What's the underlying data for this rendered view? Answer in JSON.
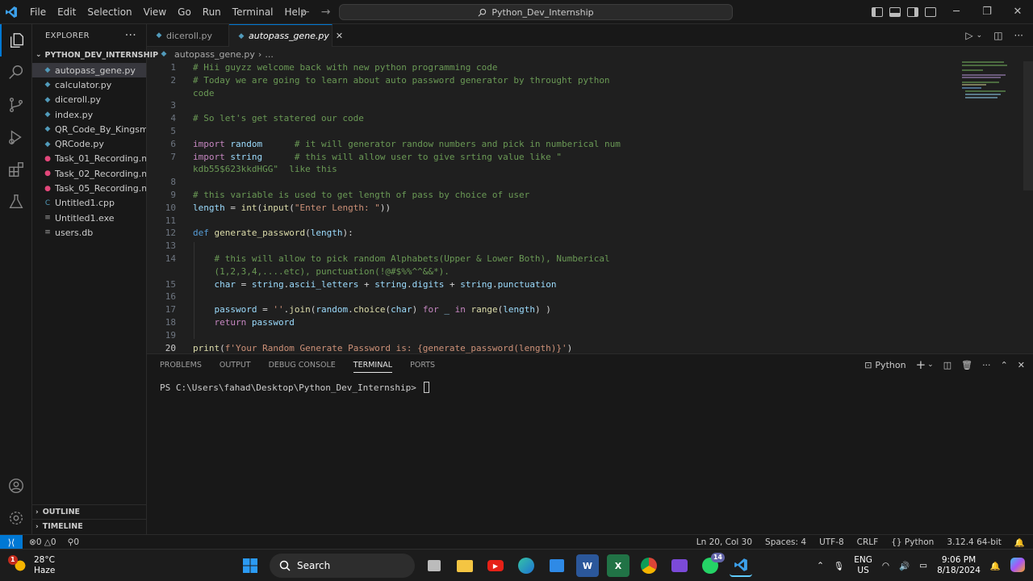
{
  "titlebar": {
    "menu": [
      "File",
      "Edit",
      "Selection",
      "View",
      "Go",
      "Run",
      "Terminal",
      "Help"
    ],
    "search": "Python_Dev_Internship"
  },
  "sidebar": {
    "title": "EXPLORER",
    "folder": "PYTHON_DEV_INTERNSHIP",
    "files": [
      {
        "name": "autopass_gene.py",
        "type": "py",
        "selected": true
      },
      {
        "name": "calculator.py",
        "type": "py"
      },
      {
        "name": "diceroll.py",
        "type": "py"
      },
      {
        "name": "index.py",
        "type": "py"
      },
      {
        "name": "QR_Code_By_Kingsm...",
        "type": "py"
      },
      {
        "name": "QRCode.py",
        "type": "py"
      },
      {
        "name": "Task_01_Recording.m...",
        "type": "mp4"
      },
      {
        "name": "Task_02_Recording.m...",
        "type": "mp4"
      },
      {
        "name": "Task_05_Recording.m...",
        "type": "mp4"
      },
      {
        "name": "Untitled1.cpp",
        "type": "cpp"
      },
      {
        "name": "Untitled1.exe",
        "type": "exe"
      },
      {
        "name": "users.db",
        "type": "db"
      }
    ],
    "outline": "OUTLINE",
    "timeline": "TIMELINE"
  },
  "tabs": [
    {
      "label": "diceroll.py",
      "active": false
    },
    {
      "label": "autopass_gene.py",
      "active": true
    }
  ],
  "breadcrumb": {
    "file": "autopass_gene.py",
    "rest": "..."
  },
  "editor": {
    "lines": [
      {
        "n": "1",
        "code": "# Hii guyzz welcome back with new python programming code"
      },
      {
        "n": "2",
        "code": "# Today we are going to learn about auto password generator by throught python"
      },
      {
        "n": "",
        "code": "code"
      },
      {
        "n": "3",
        "code": ""
      },
      {
        "n": "4",
        "code": "# So let's get statered our code"
      },
      {
        "n": "5",
        "code": ""
      },
      {
        "n": "6",
        "code": "import random      # it will generator randow numbers and pick in numberical num"
      },
      {
        "n": "7",
        "code": "import string      # this will allow user to give srting value like \""
      },
      {
        "n": "",
        "code": "kdb55$623kkdHGG\"  like this"
      },
      {
        "n": "8",
        "code": ""
      },
      {
        "n": "9",
        "code": "# this variable is used to get length of pass by choice of user"
      },
      {
        "n": "10",
        "code": "length = int(input(\"Enter Length: \"))"
      },
      {
        "n": "11",
        "code": ""
      },
      {
        "n": "12",
        "code": "def generate_password(length):"
      },
      {
        "n": "13",
        "code": ""
      },
      {
        "n": "14",
        "code": "    # this will allow to pick random Alphabets(Upper & Lower Both), Numberical"
      },
      {
        "n": "",
        "code": "    (1,2,3,4,....etc), punctuation(!@#$%%^^&&*)."
      },
      {
        "n": "15",
        "code": "    char = string.ascii_letters + string.digits + string.punctuation"
      },
      {
        "n": "16",
        "code": ""
      },
      {
        "n": "17",
        "code": "    password = ''.join(random.choice(char) for _ in range(length) )"
      },
      {
        "n": "18",
        "code": "    return password"
      },
      {
        "n": "19",
        "code": ""
      },
      {
        "n": "20",
        "code": "print(f'Your Random Generate Password is: {generate_password(length)}')"
      }
    ]
  },
  "panel": {
    "tabs": [
      "PROBLEMS",
      "OUTPUT",
      "DEBUG CONSOLE",
      "TERMINAL",
      "PORTS"
    ],
    "active_tab": "TERMINAL",
    "shell": "Python",
    "prompt": "PS C:\\Users\\fahad\\Desktop\\Python_Dev_Internship> "
  },
  "status": {
    "errors": "0",
    "warnings": "0",
    "ports": "0",
    "position": "Ln 20, Col 30",
    "spaces": "Spaces: 4",
    "encoding": "UTF-8",
    "eol": "CRLF",
    "language": "Python",
    "interpreter": "3.12.4 64-bit"
  },
  "taskbar": {
    "temp": "28°C",
    "weather": "Haze",
    "weather_badge": "1",
    "search": "Search",
    "whatsapp_badge": "14",
    "lang1": "ENG",
    "lang2": "US",
    "time": "9:06 PM",
    "date": "8/18/2024"
  },
  "colors": {
    "accent": "#0078d4",
    "background": "#1f1f1f",
    "chrome": "#181818"
  }
}
